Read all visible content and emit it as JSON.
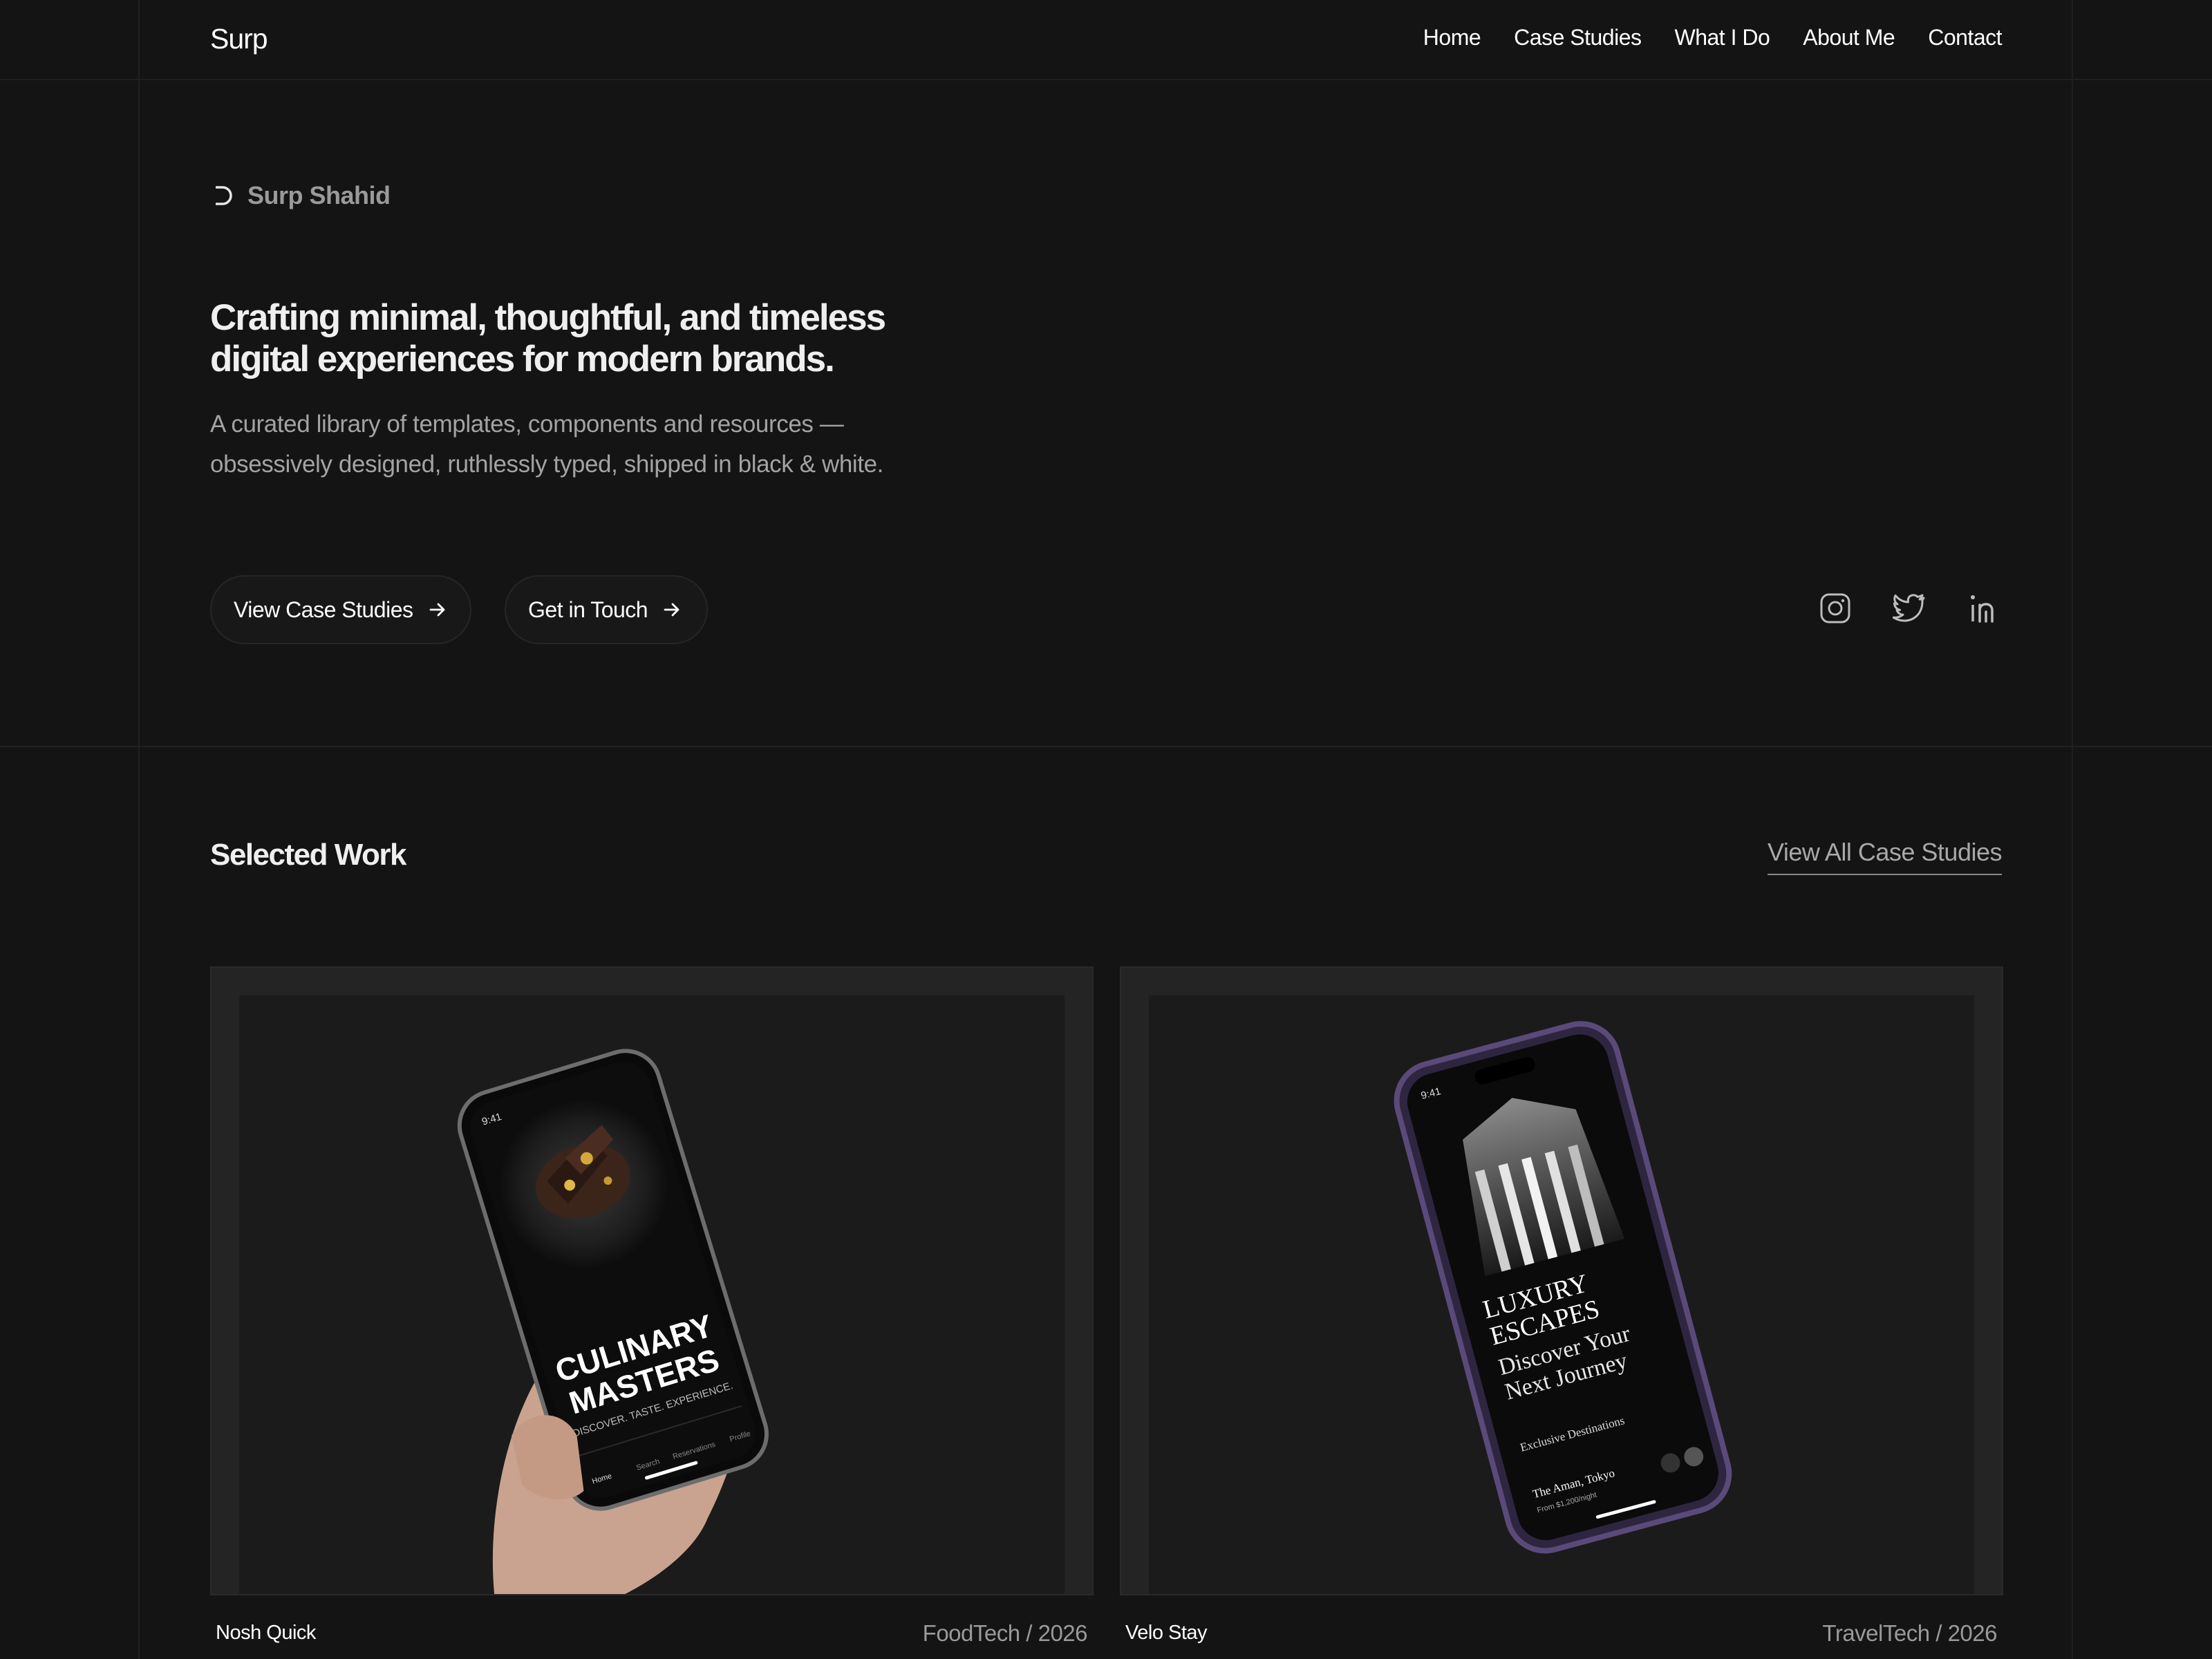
{
  "nav": {
    "logo": "Surp",
    "links": [
      "Home",
      "Case Studies",
      "What I Do",
      "About Me",
      "Contact"
    ]
  },
  "hero": {
    "brand_name": "Surp Shahid",
    "headline": "Crafting minimal, thoughtful, and timeless digital experiences for modern brands.",
    "subtext": "A curated library of templates, components and resources — obsessively designed, ruthlessly typed, shipped in black & white.",
    "primary_button": "View Case Studies",
    "secondary_button": "Get in Touch",
    "socials": [
      "instagram-icon",
      "twitter-icon",
      "linkedin-icon"
    ]
  },
  "work": {
    "title": "Selected Work",
    "view_all": "View All Case Studies",
    "projects": [
      {
        "name": "Nosh Quick",
        "meta": "FoodTech / 2026",
        "screen_time": "9:41",
        "screen_title_1": "CULINARY",
        "screen_title_2": "MASTERS",
        "screen_tagline": "DISCOVER. TASTE. EXPERIENCE.",
        "tabs": [
          "Home",
          "Search",
          "Reservations",
          "Profile"
        ]
      },
      {
        "name": "Velo Stay",
        "meta": "TravelTech / 2026",
        "screen_time": "9:41",
        "screen_title_1": "LUXURY",
        "screen_title_2": "ESCAPES",
        "screen_sub_1": "Discover Your",
        "screen_sub_2": "Next Journey",
        "screen_section": "Exclusive Destinations",
        "screen_hotel": "The Aman, Tokyo",
        "screen_price": "From $1,200/night"
      }
    ]
  },
  "colors": {
    "background": "#141414",
    "card": "#242424",
    "text": "#f2f2f2",
    "muted": "#a3a3a3"
  }
}
